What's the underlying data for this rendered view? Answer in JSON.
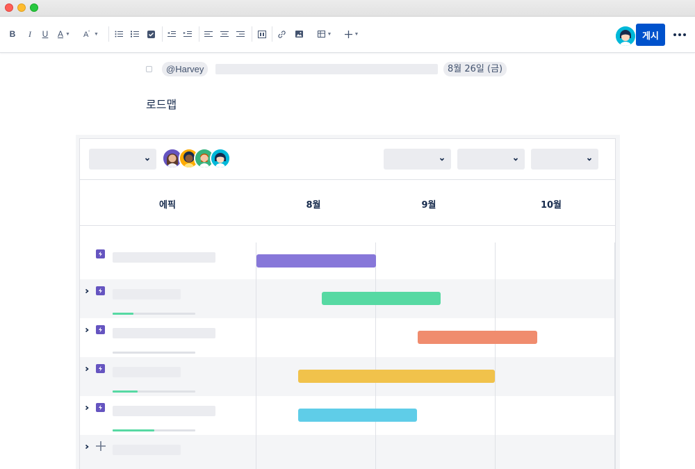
{
  "editor": {
    "toolbar": {
      "bold": "B",
      "italic": "I",
      "underline": "U",
      "text_color": "A",
      "publish_label": "게시"
    },
    "task": {
      "mention": "@Harvey",
      "due_date": "8월 26일 (금)"
    },
    "heading": "로드맵"
  },
  "roadmap": {
    "columns": {
      "epic": "에픽",
      "months": [
        "8월",
        "9월",
        "10월"
      ]
    },
    "colors": {
      "purple": "#8777d9",
      "green": "#57d9a3",
      "red": "#f08c6e",
      "yellow": "#f1c24b",
      "teal": "#5fcde8",
      "epic_icon": "#6554c0",
      "primary": "#0052cc"
    },
    "rows": [
      {
        "icon": "epic-lightning-icon",
        "expandable": false,
        "progress": null,
        "bar_color": "#8777d9"
      },
      {
        "icon": "epic-lightning-icon",
        "expandable": true,
        "progress": 0.25,
        "bar_color": "#57d9a3"
      },
      {
        "icon": "epic-lightning-icon",
        "expandable": true,
        "progress": 0.0,
        "bar_color": "#f08c6e"
      },
      {
        "icon": "epic-lightning-icon",
        "expandable": true,
        "progress": 0.3,
        "bar_color": "#f1c24b"
      },
      {
        "icon": "epic-lightning-icon",
        "expandable": true,
        "progress": 0.5,
        "bar_color": "#5fcde8"
      },
      {
        "icon": "plus-icon",
        "expandable": true,
        "progress": null,
        "bar_color": null
      }
    ]
  }
}
